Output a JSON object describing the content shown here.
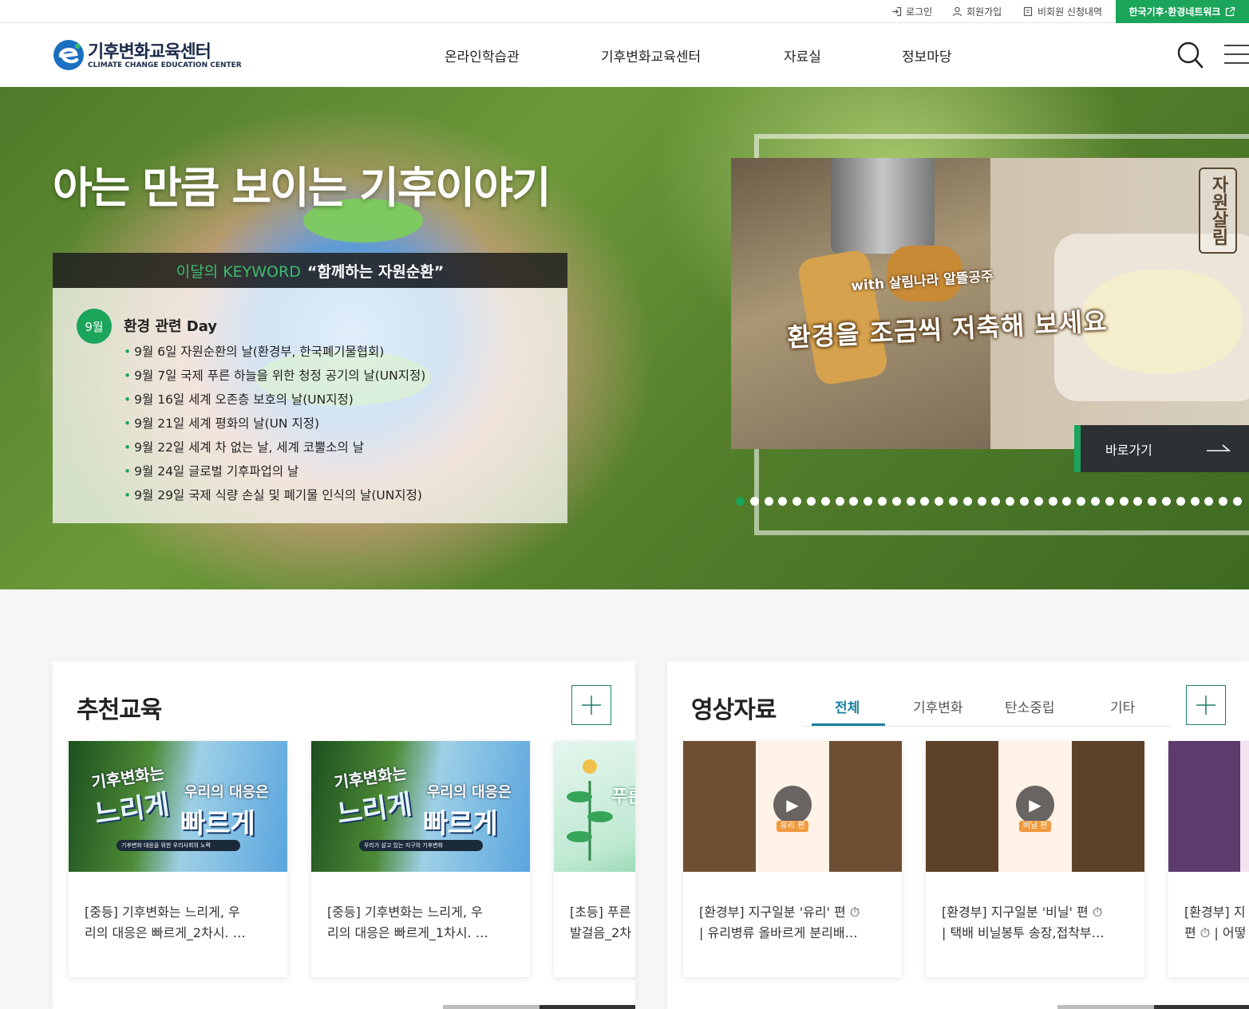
{
  "topbar": {
    "login": "로그인",
    "signup": "회원가입",
    "nonmember": "비회원 신청내역",
    "network": "한국기후·환경네트워크"
  },
  "header": {
    "logo_title": "기후변화교육센터",
    "logo_subtitle": "CLIMATE CHANGE EDUCATION CENTER",
    "nav": [
      "온라인학습관",
      "기후변화교육센터",
      "자료실",
      "정보마당"
    ]
  },
  "hero": {
    "title": "아는 만큼 보이는 기후이야기",
    "keyword_label": "이달의 KEYWORD",
    "keyword_value": "“함께하는 자원순환”",
    "month": "9월",
    "day_heading": "환경 관련 Day",
    "days": [
      "9월 6일 자원순환의 날(환경부, 한국폐기물협회)",
      "9월 7일 국제 푸른 하늘을 위한 청정 공기의 날(UN지정)",
      "9월 16일 세계 오존층 보호의 날(UN지정)",
      "9월 21일 세계 평화의 날(UN 지정)",
      "9월 22일 세계 차 없는 날, 세계 코뿔소의 날",
      "9월 24일 글로벌 기후파업의 날",
      "9월 29일 국제 식량 손실 및 폐기물 인식의 날(UN지정)"
    ],
    "slide": {
      "subtitle": "with 살림나라 알뜰공주",
      "title": "환경을 조금씩 저축해 보세요",
      "brand": "자원살림"
    },
    "go_button": "바로가기",
    "slide_count": 36,
    "active_slide": 1
  },
  "recommended": {
    "title": "추천교육",
    "cards": [
      {
        "thumb_line1": "기후변화는",
        "thumb_line2": "느리게",
        "thumb_line3": "우리의 대응은",
        "thumb_line4": "빠르게",
        "thumb_caption": "기후변화 대응을 위한 우리사회의 노력",
        "title_line1": "[중등] 기후변화는 느리게, 우",
        "title_line2": "리의 대응은 빠르게_2차시. …"
      },
      {
        "thumb_line1": "기후변화는",
        "thumb_line2": "느리게",
        "thumb_line3": "우리의 대응은",
        "thumb_line4": "빠르게",
        "thumb_caption": "우리가 살고 있는 지구의 기후변화",
        "title_line1": "[중등] 기후변화는 느리게, 우",
        "title_line2": "리의 대응은 빠르게_1차시. …"
      },
      {
        "thumb_text": "푸른 나의",
        "title_line1": "[초등] 푸른",
        "title_line2": "발걸음_2차"
      }
    ]
  },
  "videos": {
    "title": "영상자료",
    "tabs": [
      "전체",
      "기후변화",
      "탄소중립",
      "기타"
    ],
    "active_tab": "전체",
    "cards": [
      {
        "label": "유리 편",
        "title_line1": "[환경부] 지구일분 '유리' 편 ⏱",
        "title_line2": "| 유리병류 올바르게 분리배…"
      },
      {
        "label": "비닐 편",
        "title_line1": "[환경부] 지구일분 '비닐' 편 ⏱",
        "title_line2": "| 택배 비닐봉투 송장,접착부…"
      },
      {
        "title_line1": "[환경부] 지",
        "title_line2": "편 ⏱ | 어떻"
      }
    ]
  },
  "colors": {
    "accent_green": "#1aa55a",
    "tab_blue": "#1a7fa0",
    "dark": "#2d3136"
  }
}
